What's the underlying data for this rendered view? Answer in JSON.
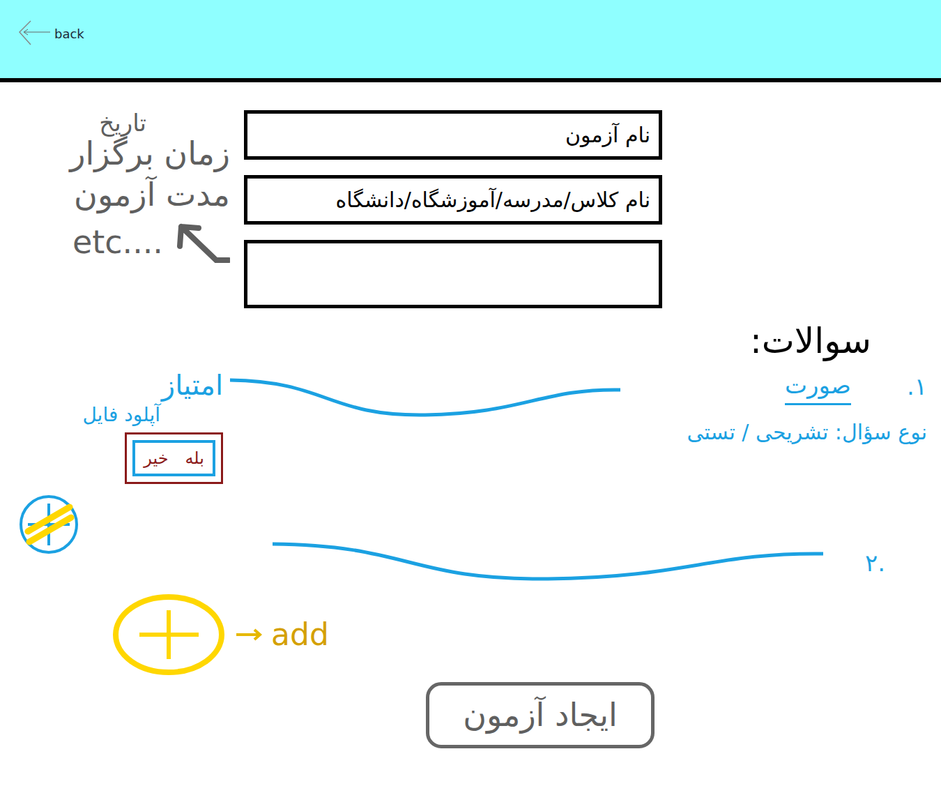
{
  "header": {
    "back": "back"
  },
  "side_note": {
    "lines": [
      "تاریخ",
      "زمان برگزار",
      "مدت آزمون",
      "etc...."
    ]
  },
  "fields": [
    {
      "label": "نام آزمون",
      "empty": false
    },
    {
      "label": "نام کلاس/مدرسه/آموزشگاه/دانشگاه",
      "empty": false
    },
    {
      "empty": true
    }
  ],
  "questions_title": "سوالات:",
  "questions": [
    {
      "number": "۱.",
      "text": "صورت",
      "score_label": "امتیاز",
      "upload_label": "آپلود فایل",
      "type_label": "نوع سؤال: تشریحی / تستی",
      "options": [
        {
          "label": "بله"
        },
        {
          "label": "خیر"
        }
      ]
    },
    {
      "number": "۲."
    }
  ],
  "add_question": {
    "label": "add"
  },
  "submit": "ایجاد آزمون"
}
